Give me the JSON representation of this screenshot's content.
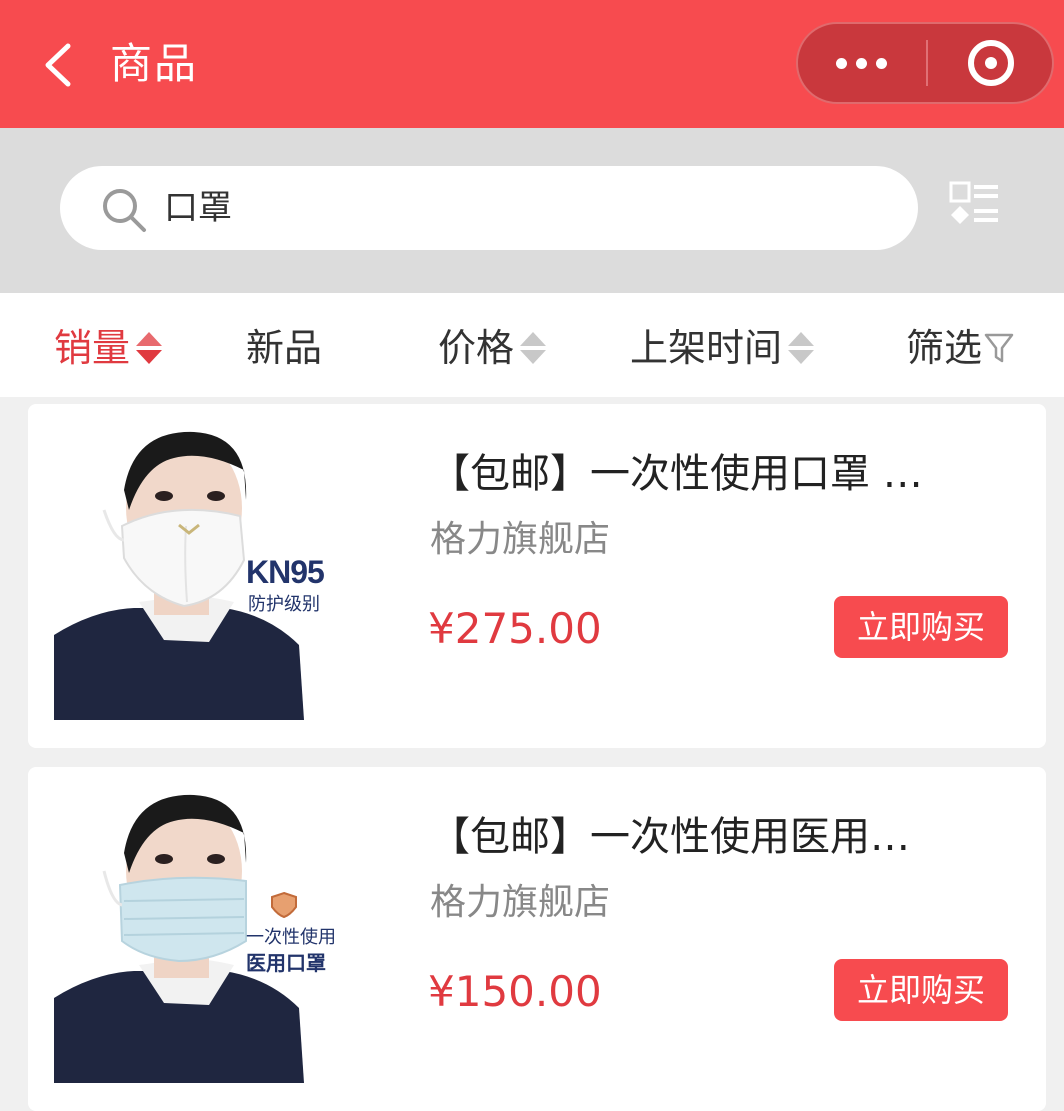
{
  "header": {
    "title": "商品"
  },
  "search": {
    "value": "口罩"
  },
  "sort_tabs": [
    {
      "label": "销量",
      "active": true
    },
    {
      "label": "新品"
    },
    {
      "label": "价格"
    },
    {
      "label": "上架时间"
    },
    {
      "label": "筛选"
    }
  ],
  "products": [
    {
      "name": "【包邮】一次性使用口罩 …",
      "shop": "格力旗舰店",
      "price": "¥275.00",
      "buy_label": "立即购买",
      "image": {
        "badge_title": "KN95",
        "badge_sub": "防护级别"
      }
    },
    {
      "name": "【包邮】一次性使用医用…",
      "shop": "格力旗舰店",
      "price": "¥150.00",
      "buy_label": "立即购买",
      "image": {
        "badge_line1": "一次性使用",
        "badge_line2": "医用口罩"
      }
    }
  ],
  "colors": {
    "brand_red": "#f74b4f",
    "price_red": "#e03a40"
  }
}
